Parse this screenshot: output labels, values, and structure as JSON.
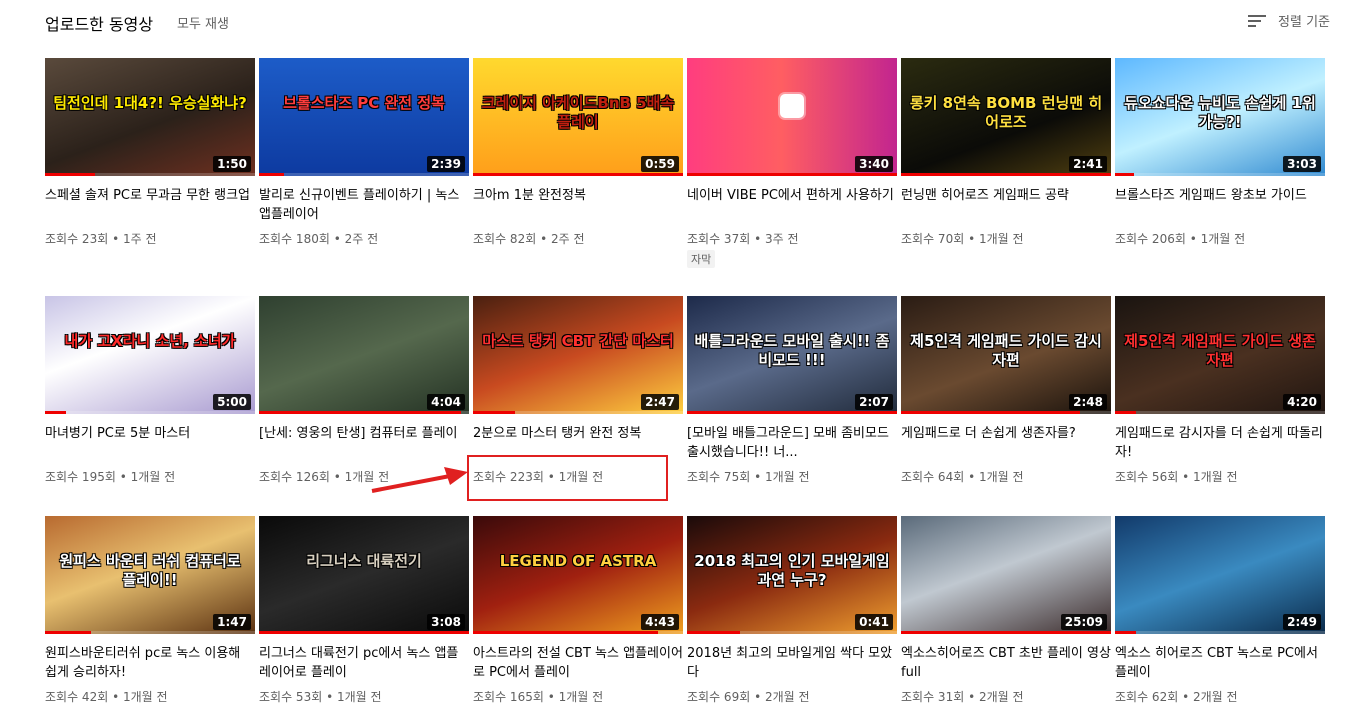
{
  "header": {
    "title": "업로드한 동영상",
    "play_all": "모두 재생",
    "sort_label": "정렬 기준",
    "sort_icon": "sort-icon"
  },
  "colors": {
    "progress": "#ee0000",
    "annotation": "#e02020"
  },
  "videos": [
    {
      "title": "스페셜 솔져 PC로 무과금 무한 랭크업",
      "views": "조회수 23회",
      "age": "1주 전",
      "duration": "1:50",
      "thumb_text": "팀전인데 1대4?! 우승실화냐?",
      "progress": 0.24
    },
    {
      "title": "발리로 신규이벤트 플레이하기 | 녹스앱플레이어",
      "views": "조회수 180회",
      "age": "2주 전",
      "duration": "2:39",
      "thumb_text": "브롤스타즈 PC 완전 정복",
      "progress": 0.12
    },
    {
      "title": "크아m 1분 완전정복",
      "views": "조회수 82회",
      "age": "2주 전",
      "duration": "0:59",
      "thumb_text": "크레이지 아케이드BnB 5배속 플레이",
      "progress": 1.0
    },
    {
      "title": "네이버 VIBE PC에서 편하게 사용하기",
      "views": "조회수 37회",
      "age": "3주 전",
      "duration": "3:40",
      "thumb_text": "",
      "progress": 1.0,
      "badge": "자막"
    },
    {
      "title": "런닝맨 히어로즈 게임패드 공략",
      "views": "조회수 70회",
      "age": "1개월 전",
      "duration": "2:41",
      "thumb_text": "롱키 8연속 BOMB 런닝맨 히어로즈",
      "progress": 1.0
    },
    {
      "title": "브롤스타즈 게임패드 왕초보 가이드",
      "views": "조회수 206회",
      "age": "1개월 전",
      "duration": "3:03",
      "thumb_text": "듀오쇼다운 뉴비도 손쉽게 1위가능?!",
      "progress": 0.09
    },
    {
      "title": "마녀병기 PC로 5분 마스터",
      "views": "조회수 195회",
      "age": "1개월 전",
      "duration": "5:00",
      "thumb_text": "내가 고X라니 소년, 소녀가",
      "progress": 0.1
    },
    {
      "title": "[난세: 영웅의 탄생] 컴퓨터로 플레이",
      "views": "조회수 126회",
      "age": "1개월 전",
      "duration": "4:04",
      "thumb_text": "",
      "progress": 0.96
    },
    {
      "title": "2분으로 마스터 탱커 완전 정복",
      "views": "조회수 223회",
      "age": "1개월 전",
      "duration": "2:47",
      "thumb_text": "마스트 탱커 CBT 간단 마스터",
      "progress": 0.2
    },
    {
      "title": "[모바일 배틀그라운드] 모배 좀비모드 출시했습니다!! 너...",
      "views": "조회수 75회",
      "age": "1개월 전",
      "duration": "2:07",
      "thumb_text": "배틀그라운드 모바일 출시!! 좀비모드 !!!",
      "progress": 1.0
    },
    {
      "title": "게임패드로 더 손쉽게 생존자를?",
      "views": "조회수 64회",
      "age": "1개월 전",
      "duration": "2:48",
      "thumb_text": "제5인격 게임패드 가이드 감시자편",
      "progress": 0.85
    },
    {
      "title": "게임패드로 감시자를 더 손쉽게 따돌리자!",
      "views": "조회수 56회",
      "age": "1개월 전",
      "duration": "4:20",
      "thumb_text": "제5인격 게임패드 가이드 생존자편",
      "progress": 0.1
    },
    {
      "title": "원피스바운티러쉬 pc로 녹스 이용해 쉽게 승리하자!",
      "views": "조회수 42회",
      "age": "1개월 전",
      "duration": "1:47",
      "thumb_text": "원피스 바운티 러쉬 컴퓨터로 플레이!!",
      "progress": 0.22
    },
    {
      "title": "리그너스 대륙전기 pc에서 녹스 앱플레이어로 플레이",
      "views": "조회수 53회",
      "age": "1개월 전",
      "duration": "3:08",
      "thumb_text": "리그너스 대륙전기",
      "progress": 1.0
    },
    {
      "title": "아스트라의 전설 CBT 녹스 앱플레이어로 PC에서 플레이",
      "views": "조회수 165회",
      "age": "1개월 전",
      "duration": "4:43",
      "thumb_text": "LEGEND OF ASTRA",
      "progress": 0.88
    },
    {
      "title": "2018년 최고의 모바일게임 싹다 모았다",
      "views": "조회수 69회",
      "age": "2개월 전",
      "duration": "0:41",
      "thumb_text": "2018 최고의 인기 모바일게임 과연 누구?",
      "progress": 0.25
    },
    {
      "title": "엑소스히어로즈 CBT 초반 플레이 영상 full",
      "views": "조회수 31회",
      "age": "2개월 전",
      "duration": "25:09",
      "thumb_text": "",
      "progress": 1.0
    },
    {
      "title": "엑소스 히어로즈 CBT 녹스로 PC에서 플레이",
      "views": "조회수 62회",
      "age": "2개월 전",
      "duration": "2:49",
      "thumb_text": "",
      "progress": 0.1
    }
  ]
}
